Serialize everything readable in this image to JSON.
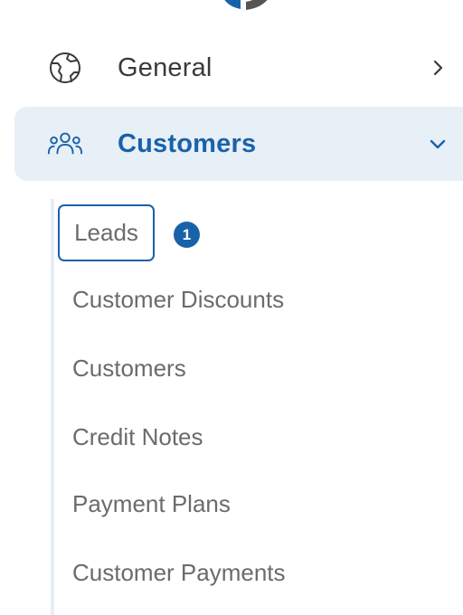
{
  "nav": {
    "general": {
      "label": "General",
      "icon": "globe-icon",
      "expanded": false
    },
    "customers": {
      "label": "Customers",
      "icon": "users-icon",
      "expanded": true
    }
  },
  "submenu": {
    "leads": {
      "label": "Leads",
      "badge": "1"
    },
    "items": [
      {
        "label": "Customer Discounts"
      },
      {
        "label": "Customers"
      },
      {
        "label": "Credit Notes"
      },
      {
        "label": "Payment Plans"
      },
      {
        "label": "Customer Payments"
      }
    ]
  },
  "colors": {
    "accent": "#1a62a8",
    "active_bg": "#e7eff7",
    "text_primary": "#3a3a3a",
    "text_secondary": "#6b6b6b",
    "rail": "#e6eef6"
  }
}
